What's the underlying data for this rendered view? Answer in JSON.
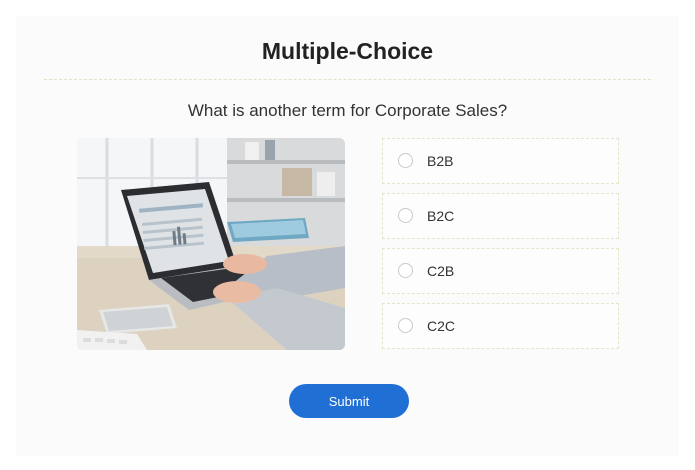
{
  "quiz": {
    "title": "Multiple-Choice",
    "question": "What is another term for Corporate Sales?",
    "options": [
      {
        "label": "B2B",
        "selected": false
      },
      {
        "label": "B2C",
        "selected": false
      },
      {
        "label": "C2B",
        "selected": false
      },
      {
        "label": "C2C",
        "selected": false
      }
    ],
    "submit_label": "Submit"
  },
  "colors": {
    "accent": "#1f6fd4",
    "title_text": "#222222",
    "body_text": "#333333",
    "option_border": "#e6e4c8"
  },
  "icons": {
    "option_marker": "radio-unchecked-icon"
  }
}
